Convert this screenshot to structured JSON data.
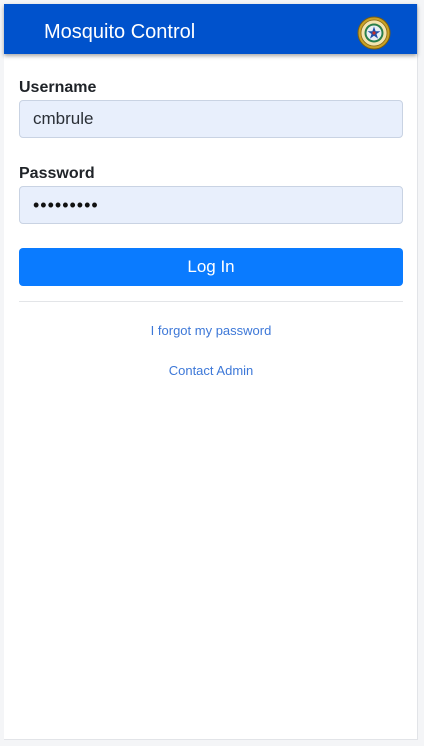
{
  "header": {
    "title": "Mosquito Control",
    "logo_icon": "county-seal-icon"
  },
  "form": {
    "username_label": "Username",
    "username_value": "cmbrule",
    "password_label": "Password",
    "password_masked": "•••••••••",
    "login_button": "Log In"
  },
  "links": {
    "forgot_password": "I forgot my password",
    "contact_admin": "Contact Admin"
  },
  "colors": {
    "header_bg": "#0052cc",
    "button_bg": "#0a7bff",
    "link": "#3d78d8",
    "input_bg": "#e8effc"
  }
}
